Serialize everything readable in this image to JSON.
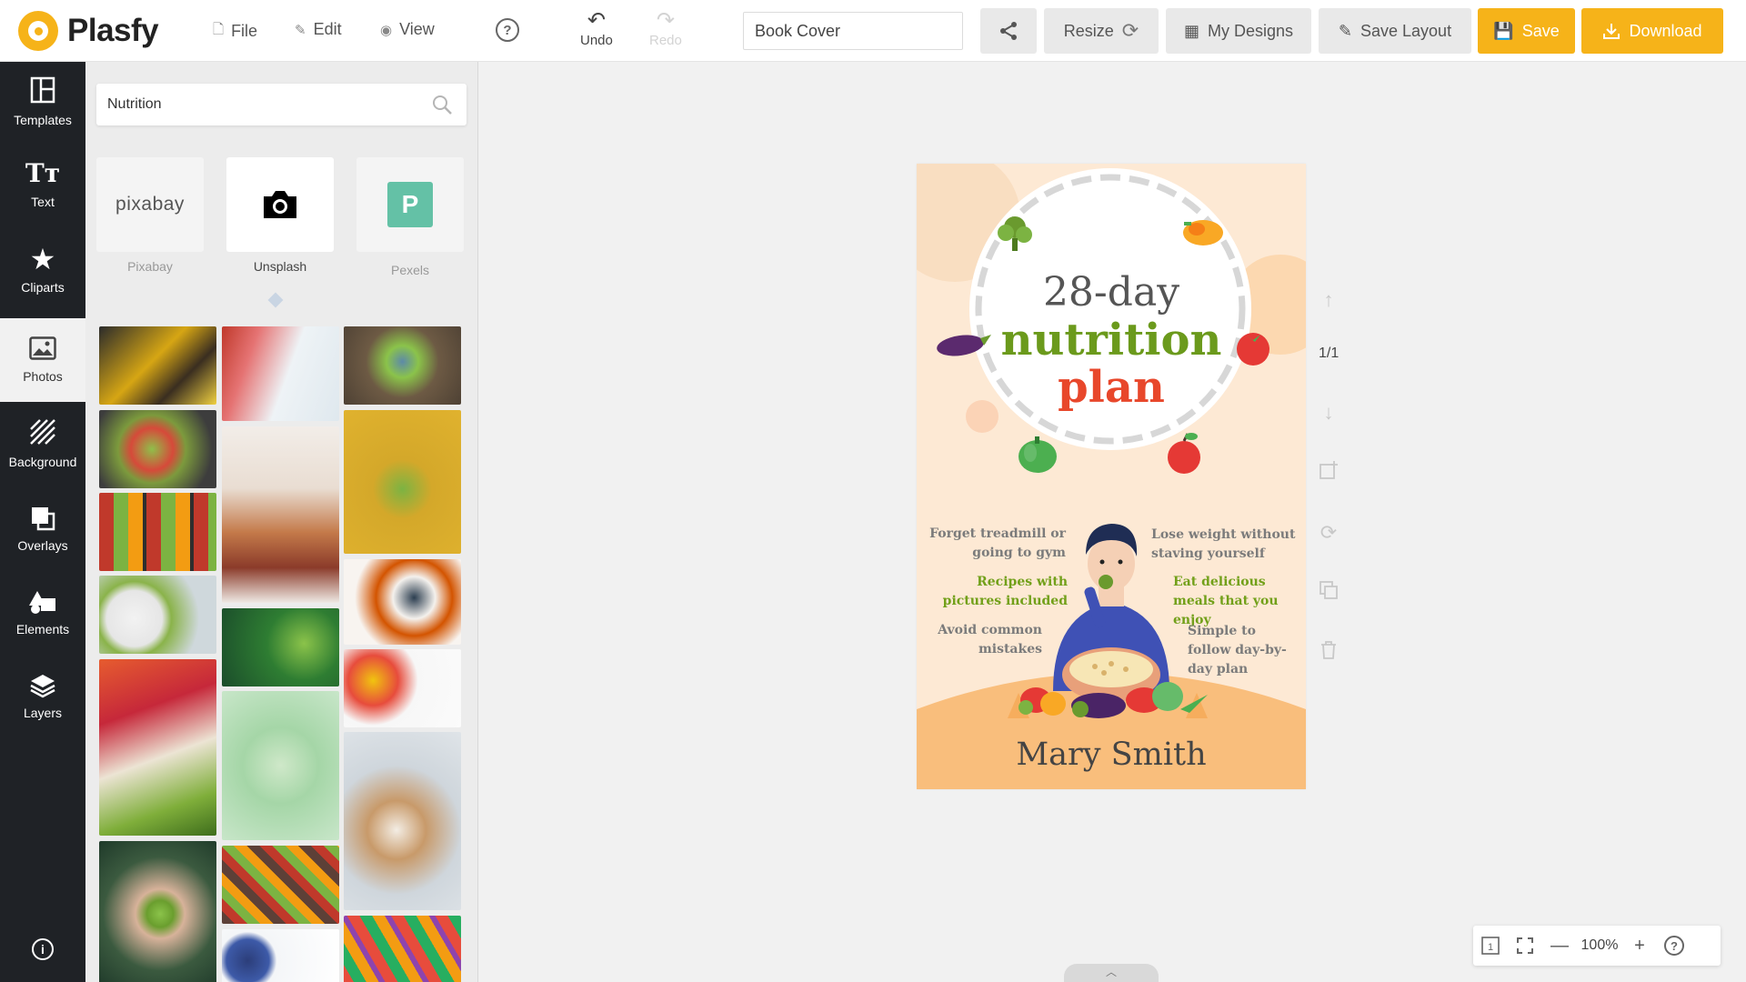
{
  "app": {
    "name": "Plasfy"
  },
  "menu": {
    "file": "File",
    "edit": "Edit",
    "view": "View"
  },
  "history": {
    "undo": "Undo",
    "redo": "Redo"
  },
  "document": {
    "name": "Book Cover"
  },
  "toolbar": {
    "resize": "Resize",
    "my_designs": "My Designs",
    "save_layout": "Save Layout",
    "save": "Save",
    "download": "Download"
  },
  "sidebar": {
    "items": [
      {
        "label": "Templates",
        "icon": "templates-icon"
      },
      {
        "label": "Text",
        "icon": "text-icon"
      },
      {
        "label": "Cliparts",
        "icon": "star-icon"
      },
      {
        "label": "Photos",
        "icon": "photo-icon",
        "active": true
      },
      {
        "label": "Background",
        "icon": "background-icon"
      },
      {
        "label": "Overlays",
        "icon": "overlays-icon"
      },
      {
        "label": "Elements",
        "icon": "shapes-icon"
      },
      {
        "label": "Layers",
        "icon": "layers-icon"
      }
    ]
  },
  "photos_panel": {
    "search_value": "Nutrition",
    "sources": [
      {
        "label": "Pixabay",
        "logo_text": "pixabay"
      },
      {
        "label": "Unsplash",
        "active": true
      },
      {
        "label": "Pexels",
        "logo_text": "P"
      }
    ]
  },
  "cover": {
    "title_line1": "28-day",
    "title_line2": "nutrition",
    "title_line3": "plan",
    "bullets": {
      "b1": "Forget treadmill or going to gym",
      "b2": "Recipes with pictures included",
      "b3": "Avoid common mistakes",
      "b4": "Lose weight without staving yourself",
      "b5": "Eat delicious meals that you enjoy",
      "b6": "Simple to follow day-by-day plan"
    },
    "author": "Mary Smith",
    "colors": {
      "background": "#fde9d4",
      "green": "#6b9a1c",
      "red": "#e8472b",
      "ground": "#f9be7c"
    }
  },
  "canvas": {
    "page_count": "1/1",
    "zoom": "100%"
  },
  "colors": {
    "accent": "#f6b319",
    "sidebar": "#1f2226"
  }
}
